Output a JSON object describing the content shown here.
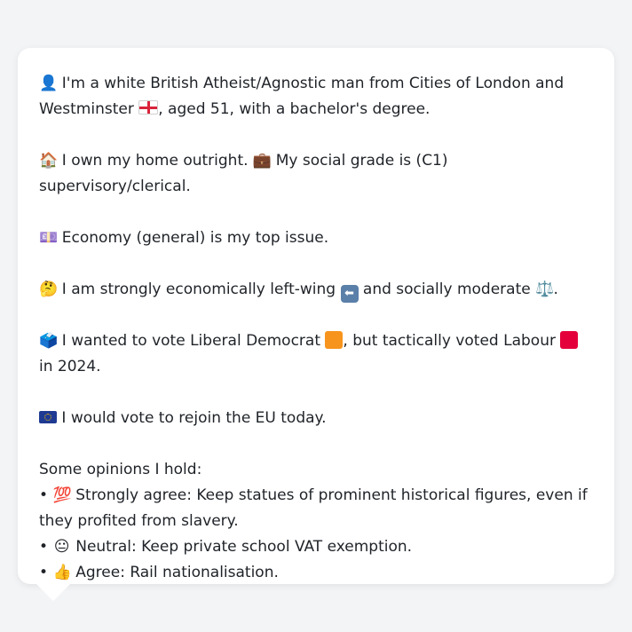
{
  "profile": {
    "line1": "I'm a white British Atheist/Agnostic man from Cities of London and Westminster",
    "line1_tail": ", aged 51, with a bachelor's degree.",
    "home": "I own my home outright.",
    "grade": "My social grade is (C1) supervisory/clerical.",
    "issue": "Economy (general) is my top issue.",
    "politics_a": "I am strongly economically left-wing",
    "politics_b": "and socially moderate",
    "politics_end": ".",
    "vote_a": "I wanted to vote Liberal Democrat",
    "vote_b": ", but tactically voted Labour",
    "vote_c": "in 2024.",
    "eu": "I would vote to rejoin the EU today.",
    "opinions_heading": "Some opinions I hold:",
    "opinions": [
      {
        "bullet": "•",
        "emoji": "💯",
        "text": "Strongly agree: Keep statues of prominent historical figures, even if they profited from slavery."
      },
      {
        "bullet": "•",
        "emoji": "😐",
        "text": "Neutral: Keep private school VAT exemption."
      },
      {
        "bullet": "•",
        "emoji": "👍",
        "text": "Agree: Rail nationalisation."
      }
    ]
  },
  "icons": {
    "person": "👤",
    "house": "🏠",
    "briefcase": "💼",
    "money": "💷",
    "thinking": "🤔",
    "scales": "⚖️",
    "ballot": "🗳️",
    "left_arrow": "⬅"
  },
  "colors": {
    "libdem": "#f7941d",
    "labour": "#e4003b",
    "card_bg": "#ffffff",
    "page_bg": "#f3f4f6"
  }
}
